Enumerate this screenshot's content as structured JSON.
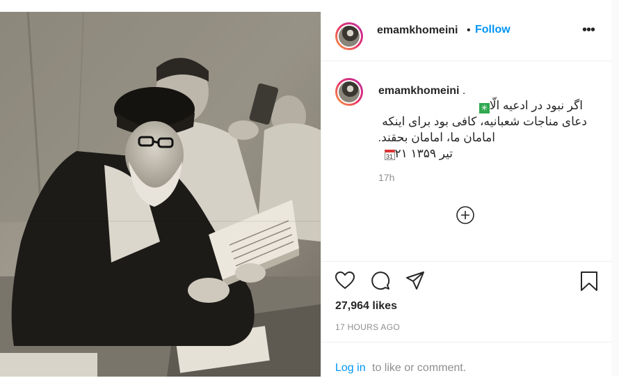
{
  "post": {
    "username": "emamkhomeini",
    "follow_separator": "•",
    "follow_label": "Follow",
    "more_label": "•••"
  },
  "caption": {
    "username": "emamkhomeini",
    "suffix": " .",
    "lines": [
      "اگر نبود در ادعیه الّا",
      "دعای مناجات شعبانیه، کافی بود برای اینکه",
      "امامان ما، امامان بحقند.",
      "تیر ۱۳۵۹ ۲۱"
    ],
    "emoji_line1": "✳",
    "emoji_line4": "31",
    "time_ago": "17h"
  },
  "engagement": {
    "likes": "27,964 likes",
    "timestamp": "17 HOURS AGO"
  },
  "footer": {
    "login_link": "Log in",
    "login_rest": " to like or comment."
  },
  "icons": [
    "heart-icon",
    "comment-icon",
    "share-icon",
    "bookmark-icon",
    "plus-circle-icon",
    "more-icon"
  ],
  "colors": {
    "link": "#0095f6",
    "muted": "#8e8e8e",
    "text": "#262626"
  }
}
